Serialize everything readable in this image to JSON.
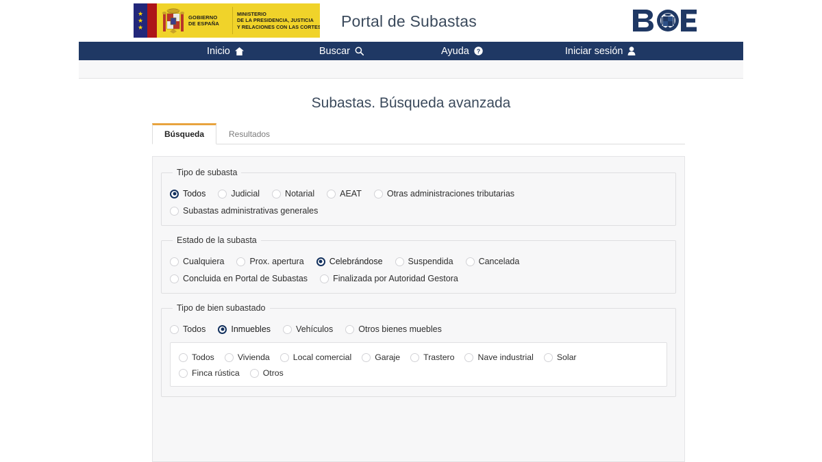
{
  "header": {
    "gov_line1": "GOBIERNO\nDE ESPAÑA",
    "gov_line1_a": "GOBIERNO",
    "gov_line1_b": "DE ESPAÑA",
    "gov_line2_a": "MINISTERIO",
    "gov_line2_b": "DE LA PRESIDENCIA, JUSTICIA",
    "gov_line2_c": "Y RELACIONES CON LAS CORTES",
    "portal_title": "Portal de Subastas",
    "boe_logo_text": "BOE"
  },
  "nav": {
    "items": [
      {
        "label": "Inicio",
        "icon": "home-icon"
      },
      {
        "label": "Buscar",
        "icon": "search-icon"
      },
      {
        "label": "Ayuda",
        "icon": "help-icon"
      },
      {
        "label": "Iniciar sesión",
        "icon": "user-icon"
      }
    ]
  },
  "main": {
    "page_title": "Subastas. Búsqueda avanzada",
    "tabs": [
      {
        "label": "Búsqueda",
        "active": true
      },
      {
        "label": "Resultados",
        "active": false
      }
    ]
  },
  "form": {
    "groups": [
      {
        "legend": "Tipo de subasta",
        "rows": [
          [
            {
              "label": "Todos",
              "checked": true
            },
            {
              "label": "Judicial",
              "checked": false
            },
            {
              "label": "Notarial",
              "checked": false
            },
            {
              "label": "AEAT",
              "checked": false
            },
            {
              "label": "Otras administraciones tributarias",
              "checked": false
            }
          ],
          [
            {
              "label": "Subastas administrativas generales",
              "checked": false
            }
          ]
        ]
      },
      {
        "legend": "Estado de la subasta",
        "rows": [
          [
            {
              "label": "Cualquiera",
              "checked": false
            },
            {
              "label": "Prox. apertura",
              "checked": false
            },
            {
              "label": "Celebrándose",
              "checked": true
            },
            {
              "label": "Suspendida",
              "checked": false
            },
            {
              "label": "Cancelada",
              "checked": false
            }
          ],
          [
            {
              "label": "Concluida en Portal de Subastas",
              "checked": false
            },
            {
              "label": "Finalizada por Autoridad Gestora",
              "checked": false
            }
          ]
        ]
      },
      {
        "legend": "Tipo de bien subastado",
        "rows": [
          [
            {
              "label": "Todos",
              "checked": false
            },
            {
              "label": "Inmuebles",
              "checked": true
            },
            {
              "label": "Vehículos",
              "checked": false
            },
            {
              "label": "Otros bienes muebles",
              "checked": false
            }
          ]
        ],
        "subpanel_rows": [
          [
            {
              "label": "Todos",
              "checked": false
            },
            {
              "label": "Vivienda",
              "checked": false
            },
            {
              "label": "Local comercial",
              "checked": false
            },
            {
              "label": "Garaje",
              "checked": false
            },
            {
              "label": "Trastero",
              "checked": false
            },
            {
              "label": "Nave industrial",
              "checked": false
            },
            {
              "label": "Solar",
              "checked": false
            }
          ],
          [
            {
              "label": "Finca rústica",
              "checked": false
            },
            {
              "label": "Otros",
              "checked": false
            }
          ]
        ]
      }
    ]
  },
  "colors": {
    "nav_bg": "#1f3864",
    "accent_tab": "#e8a33d",
    "radio_checked": "#13315e",
    "flag_yellow": "#f0d32a",
    "flag_red": "#ad1519",
    "flag_blue": "#22277a",
    "title_text": "#3b4a5c"
  }
}
